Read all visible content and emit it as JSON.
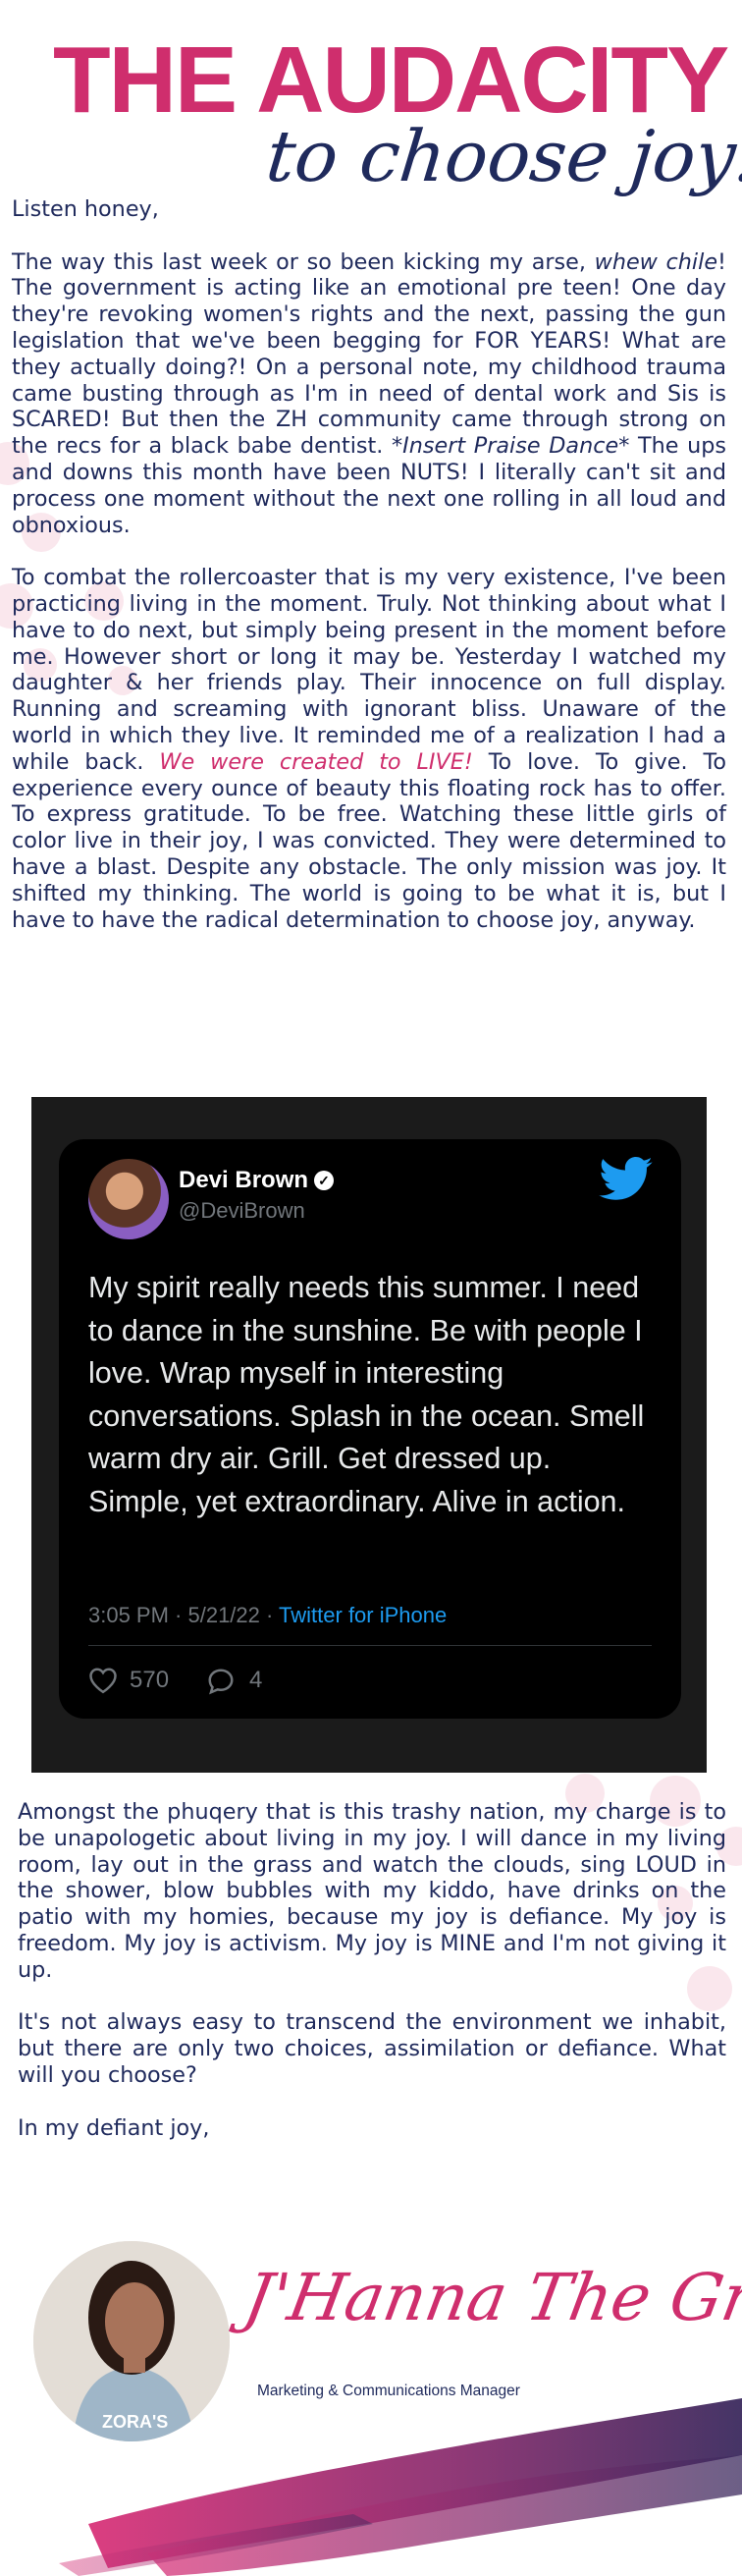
{
  "header": {
    "title_main": "THE AUDACITY",
    "title_sub": "to choose joy!"
  },
  "letter": {
    "greeting": "Listen honey,",
    "p1": [
      "The way this last week or so been kicking my arse, ",
      "whew chile",
      "!  The government is acting like an emotional pre teen!  One day they're revoking women's rights and the next, passing the gun legislation that we've been begging for FOR YEARS!  What are they actually doing?!   On a personal note, my childhood trauma came busting through as I'm in need of dental work and Sis is SCARED!  But then the ZH community came through strong on the recs for a black babe dentist.  *",
      "Insert Praise Dance",
      "*  The ups and downs this month have been NUTS! I literally can't sit and process one moment without the next one rolling in all loud and obnoxious."
    ],
    "p2": [
      "To combat the rollercoaster that is my very existence, I've been practicing living in the moment.  Truly.  Not thinking about what I have to do next, but simply being present in the moment before me.  However short or long it may be. Yesterday I watched my daughter & her friends play.  Their innocence on full display. Running and screaming with ignorant bliss.  Unaware of the world in which they live.  It reminded me of a realization I had a while back.  ",
      "We were created to LIVE!",
      "  To love.  To give.  To experience every ounce of beauty this floating rock has to offer.  To express gratitude.  To be free.  Watching these little girls of color live in their joy, I was convicted.  They were determined to have a blast. Despite any obstacle.  The only mission was joy.  It shifted my thinking.  The world is going to be what it is, but I have to have the radical determination to choose joy, anyway."
    ],
    "p3": "Amongst the phuqery that is this trashy nation, my charge is to be unapologetic about living in my joy. I will dance in my living room, lay out in the grass and watch the clouds, sing LOUD in the shower, blow bubbles with my kiddo, have drinks on the patio with my homies, because my joy is defiance. My joy is freedom. My joy is activism. My joy is MINE and I'm not giving it up.",
    "p4": "It's not always easy to transcend the environment we inhabit, but there are only two choices, assimilation or defiance.  What will you choose?",
    "closing": "In my defiant joy,"
  },
  "tweet": {
    "name": "Devi Brown",
    "handle": "@DeviBrown",
    "body": "My spirit really needs this summer. I need to dance in the sunshine. Be with people I love. Wrap myself in interesting conversations. Splash in the ocean. Smell warm dry air. Grill. Get dressed up. Simple, yet extraordinary. Alive in action.",
    "time": "3:05 PM · 5/21/22 · ",
    "source": "Twitter for iPhone",
    "likes": "570",
    "replies": "4",
    "icons": [
      "verified-badge-icon",
      "twitter-bird-icon",
      "heart-icon",
      "reply-bubble-icon"
    ],
    "colors": {
      "card": "#000000",
      "accent": "#1d9bf0",
      "muted": "#71767b"
    }
  },
  "signature": {
    "name": "J'Hanna The Great",
    "role": "Marketing & Communications Manager",
    "shirt_text": "ZORA'S"
  },
  "colors": {
    "brand_pink": "#cf2e6d",
    "navy": "#1f2a5c"
  }
}
